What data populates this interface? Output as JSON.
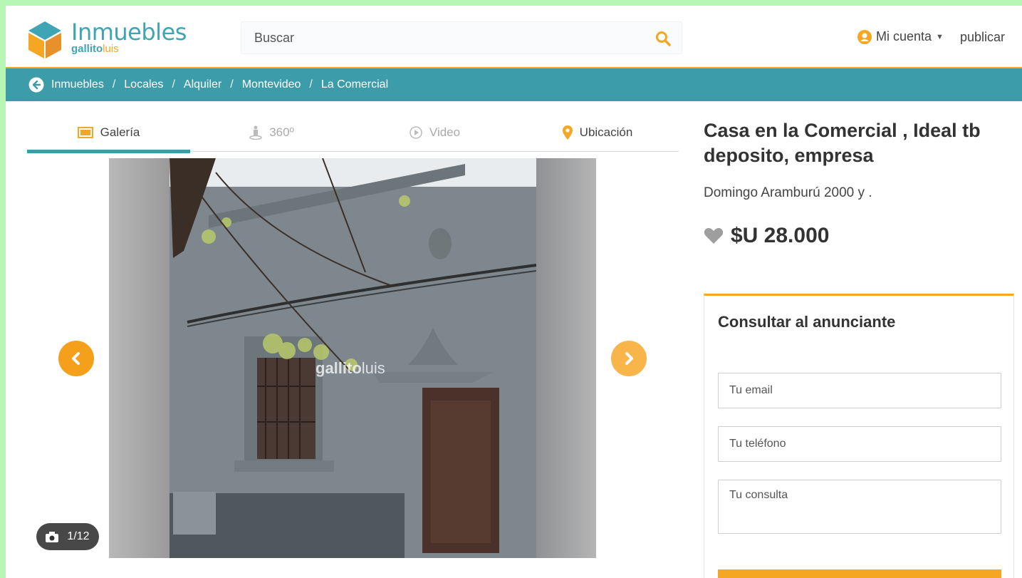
{
  "header": {
    "logo_main": "Inmuebles",
    "logo_sub_bold": "gallito",
    "logo_sub_light": "luis",
    "search_placeholder": "Buscar",
    "account_label": "Mi cuenta",
    "publish_label": "publicar"
  },
  "breadcrumb": {
    "items": [
      "Inmuebles",
      "Locales",
      "Alquiler",
      "Montevideo",
      "La Comercial"
    ],
    "separator": "/"
  },
  "tabs": [
    {
      "label": "Galería",
      "icon": "gallery-icon",
      "active": true
    },
    {
      "label": "360º",
      "icon": "person-360-icon",
      "active": false
    },
    {
      "label": "Video",
      "icon": "play-icon",
      "active": false
    },
    {
      "label": "Ubicación",
      "icon": "map-pin-icon",
      "active": false
    }
  ],
  "gallery": {
    "counter": "1/12",
    "watermark_bold": "gallito",
    "watermark_light": "luis"
  },
  "listing": {
    "title": "Casa en la Comercial , Ideal tb deposito, empresa",
    "address": "Domingo Aramburú 2000 y .",
    "price": "$U 28.000"
  },
  "contact": {
    "title": "Consultar al anunciante",
    "email_placeholder": "Tu email",
    "phone_placeholder": "Tu teléfono",
    "message_placeholder": "Tu consulta"
  },
  "colors": {
    "accent_orange": "#f5a623",
    "accent_teal": "#3d9caa",
    "frame_green": "#b6f7b4"
  }
}
